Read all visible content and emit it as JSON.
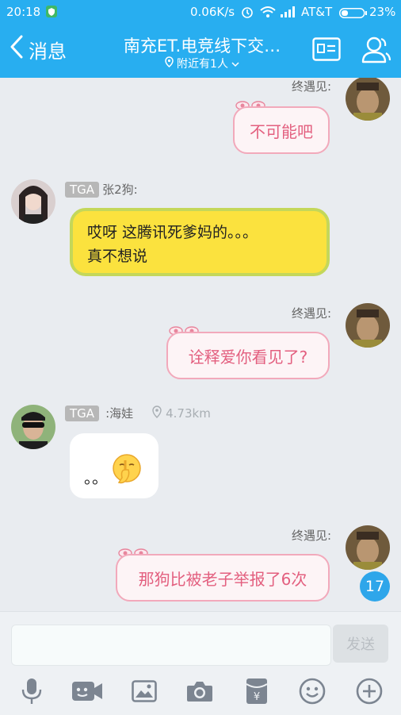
{
  "status": {
    "time": "20:18",
    "speed": "0.06K/s",
    "carrier": "AT&T",
    "battery": "23%"
  },
  "header": {
    "back_label": "消息",
    "title": "南充ET.电竞线下交…",
    "subtitle": "附近有1人"
  },
  "messages": [
    {
      "side": "right",
      "sender": "终遇见:",
      "text": "不可能吧"
    },
    {
      "side": "left",
      "badge": "TGA",
      "sender": "张2狗:",
      "lines": [
        "哎呀  这腾讯死爹妈的。。。",
        "真不想说"
      ]
    },
    {
      "side": "right",
      "sender": "终遇见:",
      "text": "诠释爱你看见了?"
    },
    {
      "side": "left",
      "badge": "TGA",
      "sender": ":海娃",
      "distance": "4.73km",
      "text": "。。"
    },
    {
      "side": "right",
      "sender": "终遇见:",
      "text": "那狗比被老子举报了6次"
    }
  ],
  "unread_count": "17",
  "input": {
    "placeholder": "",
    "send_label": "发送"
  },
  "toolbar_icons": [
    "mic-icon",
    "video-icon",
    "image-icon",
    "camera-icon",
    "red-packet-icon",
    "emoji-icon",
    "plus-icon"
  ],
  "colors": {
    "brand": "#28aef0",
    "pink_bubble_text": "#e35f7f",
    "pink_bubble_border": "#f2a9bb",
    "yellow_bubble": "#fbe23e",
    "yellow_bubble_border": "#c4d75a",
    "badge": "#2ea6ea"
  }
}
